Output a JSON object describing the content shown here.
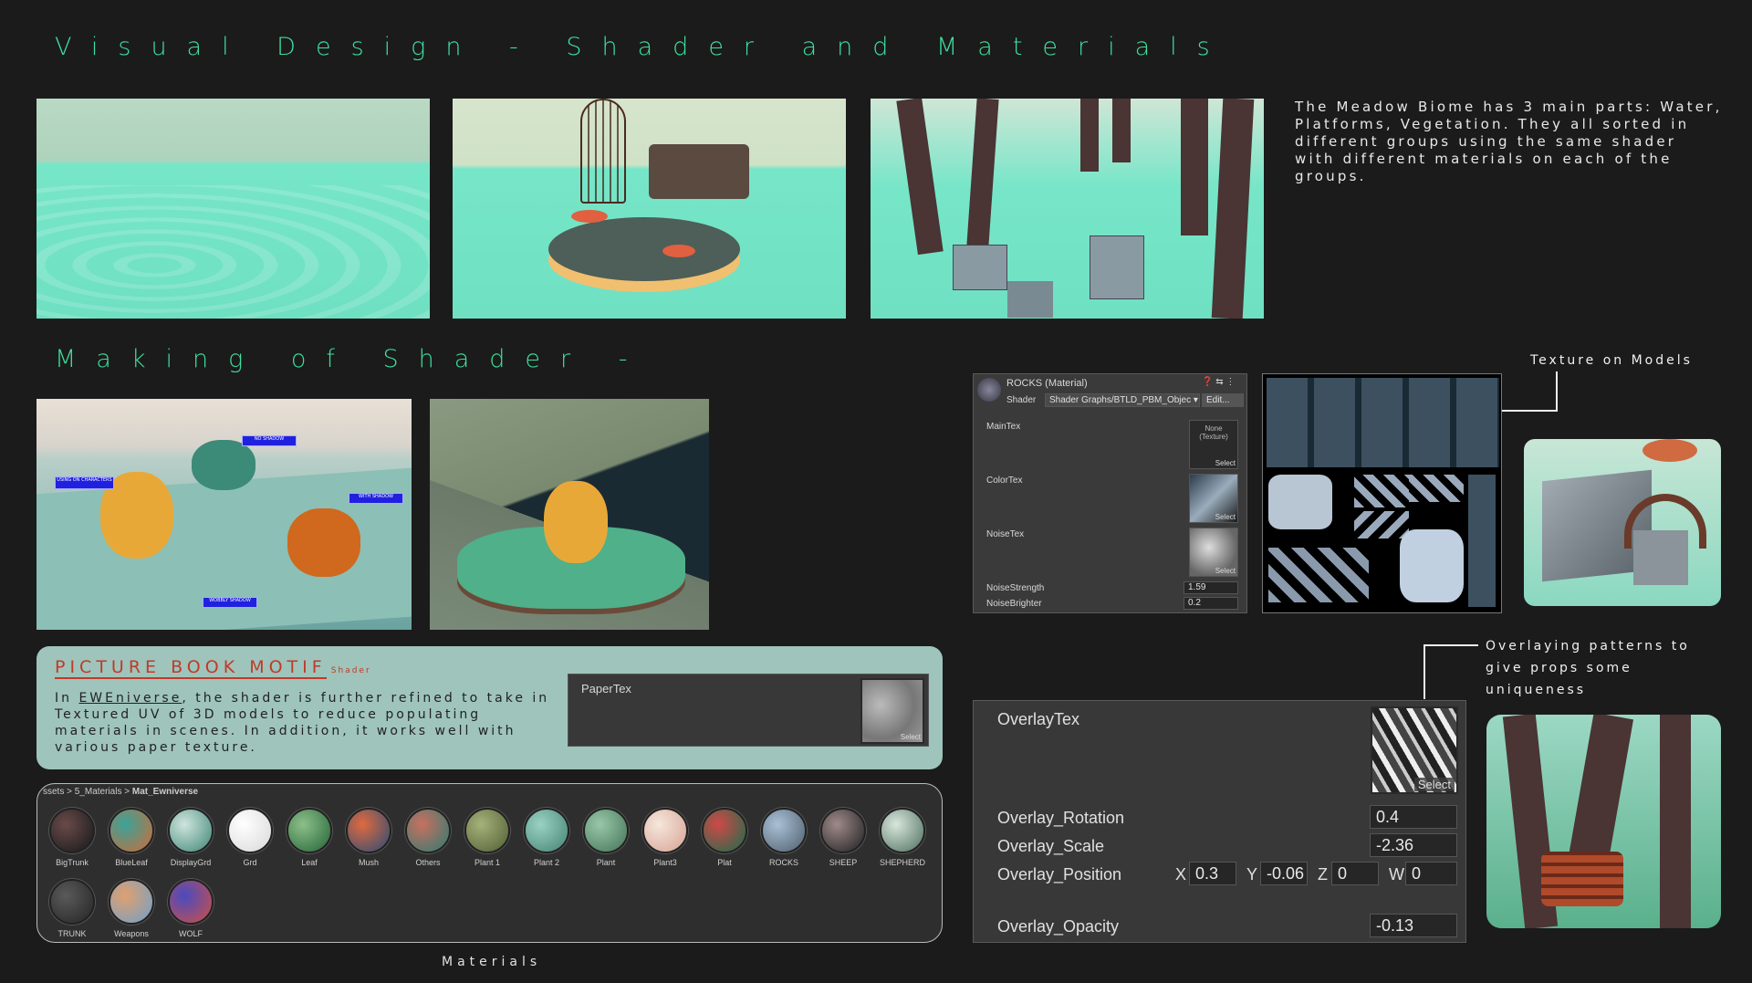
{
  "titles": {
    "main": "Visual Design - Shader and Materials",
    "making": "Making of Shader -",
    "materials": "Materials"
  },
  "description": "The Meadow Biome has 3 main parts: Water, Platforms, Vegetation. They all sorted in different groups using the same shader with different materials on each of the groups.",
  "captions": {
    "texture_models": "Texture on Models",
    "overlay": "Overlaying patterns to give props some uniqueness"
  },
  "demo_tags": {
    "no_shadow": "NO SHADOW",
    "using_on_characters": "USING ON CHARACTERS",
    "with_shadow": "WITH SHADOW",
    "wobbly_shadow": "WOBBLY SHADOW"
  },
  "motif": {
    "title": "PICTURE BOOK MOTIF",
    "subtitle": "Shader",
    "text_before": "In ",
    "link": "EWEniverse",
    "text_after": ", the shader is further refined to take in Textured UV of 3D models to reduce populating materials in scenes. In addition, it works well with various paper texture.",
    "paper_label": "PaperTex",
    "select": "Select"
  },
  "breadcrumb": {
    "a": "ssets",
    "b": "5_Materials",
    "c": "Mat_Ewniverse",
    "sep": ">"
  },
  "materials": [
    {
      "name": "BigTrunk",
      "c1": "#6a4a4a",
      "c2": "#1e1e1e"
    },
    {
      "name": "BlueLeaf",
      "c1": "#3aa39a",
      "c2": "#c07040"
    },
    {
      "name": "DisplayGrd",
      "c1": "#cfe5dd",
      "c2": "#4c8f80"
    },
    {
      "name": "Grd",
      "c1": "#ffffff",
      "c2": "#dcdcdc"
    },
    {
      "name": "Leaf",
      "c1": "#8cc08a",
      "c2": "#2f6c3f"
    },
    {
      "name": "Mush",
      "c1": "#e06a40",
      "c2": "#3a4f70"
    },
    {
      "name": "Others",
      "c1": "#c87060",
      "c2": "#3c7a70"
    },
    {
      "name": "Plant 1",
      "c1": "#a6b27a",
      "c2": "#58663a"
    },
    {
      "name": "Plant 2",
      "c1": "#9ad2c2",
      "c2": "#4c8a7a"
    },
    {
      "name": "Plant",
      "c1": "#98c8a8",
      "c2": "#4c7a60"
    },
    {
      "name": "Plant3",
      "c1": "#f6e6dc",
      "c2": "#d8aa9a"
    },
    {
      "name": "Plat",
      "c1": "#d04848",
      "c2": "#2a6a4a"
    },
    {
      "name": "ROCKS",
      "c1": "#aac0d4",
      "c2": "#566878"
    },
    {
      "name": "SHEEP",
      "c1": "#a08a8a",
      "c2": "#2a2a2a"
    },
    {
      "name": "SHEPHERD",
      "c1": "#d8e6dc",
      "c2": "#5a7a6a"
    },
    {
      "name": "TRUNK",
      "c1": "#5a5a5a",
      "c2": "#2a2a2a"
    },
    {
      "name": "Weapons",
      "c1": "#e0a070",
      "c2": "#7aa0c0"
    },
    {
      "name": "WOLF",
      "c1": "#4a4ac0",
      "c2": "#c05050"
    }
  ],
  "inspector": {
    "title": "ROCKS (Material)",
    "shader_label": "Shader",
    "shader_value": "Shader Graphs/BTLD_PBM_Objec",
    "edit": "Edit...",
    "maintex": "MainTex",
    "none_texture": "None (Texture)",
    "colortex": "ColorTex",
    "noisetex": "NoiseTex",
    "select": "Select",
    "noise_strength_label": "NoiseStrength",
    "noise_strength": "1.59",
    "noise_brighter_label": "NoiseBrighter",
    "noise_brighter": "0.2"
  },
  "overlay": {
    "tex_label": "OverlayTex",
    "select": "Select",
    "rotation_label": "Overlay_Rotation",
    "rotation": "0.4",
    "scale_label": "Overlay_Scale",
    "scale": "-2.36",
    "position_label": "Overlay_Position",
    "x_label": "X",
    "x": "0.3",
    "y_label": "Y",
    "y": "-0.06",
    "z_label": "Z",
    "z": "0",
    "w_label": "W",
    "w": "0",
    "opacity_label": "Overlay_Opacity",
    "opacity": "-0.13"
  },
  "colors": {
    "accent": "#3ee0a0",
    "motif_title": "#c03a2a",
    "panel_bg": "#9fc4bb",
    "water": "#7fe6c8"
  }
}
